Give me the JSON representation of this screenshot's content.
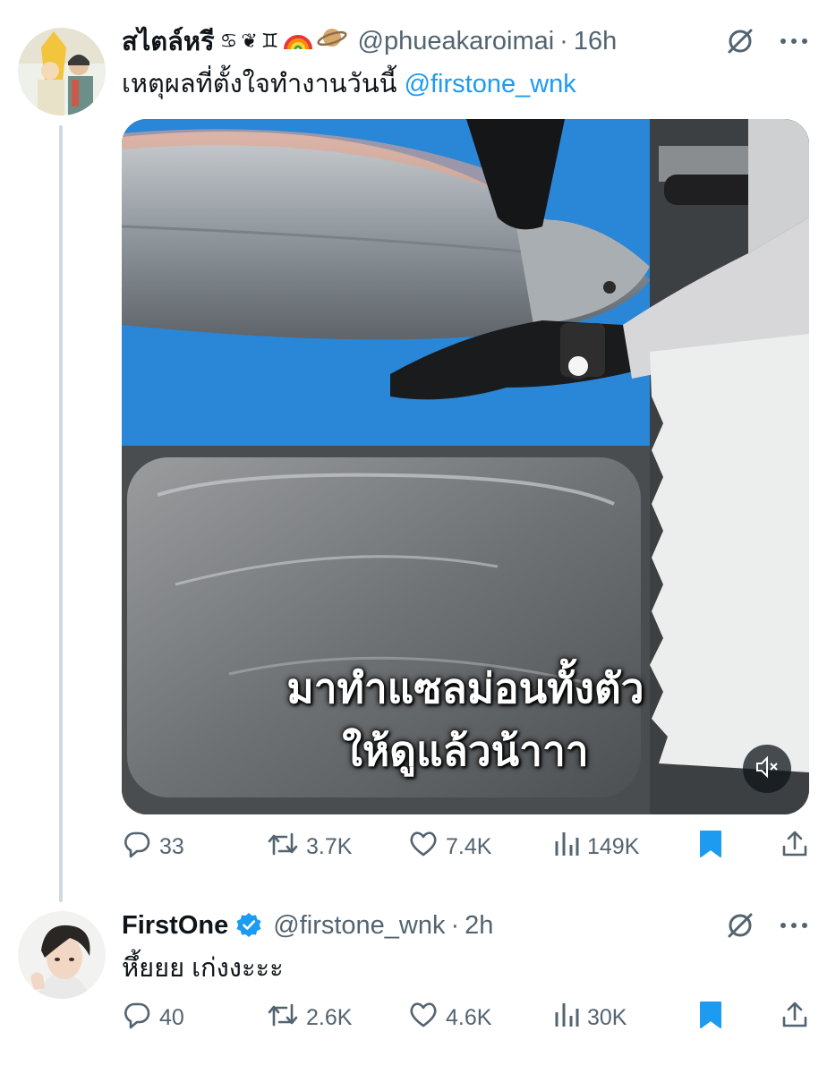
{
  "tweets": [
    {
      "display_name": "สไตล์หรี",
      "emojis": [
        "♋",
        "❦",
        "♊",
        "rainbow",
        "planet"
      ],
      "handle": "@phueakaroimai",
      "time": "16h",
      "text": "เหตุผลที่ตั้งใจทำงานวันนี้",
      "mention": "@firstone_wnk",
      "video": {
        "caption_line1": "มาทำแซลม่อนทั้งตัว",
        "caption_line2": "ให้ดูแล้วน้าาา",
        "muted": true
      },
      "stats": {
        "replies": "33",
        "retweets": "3.7K",
        "likes": "7.4K",
        "views": "149K",
        "bookmarked": true
      }
    },
    {
      "display_name": "FirstOne",
      "verified": true,
      "handle": "@firstone_wnk",
      "time": "2h",
      "text": "หึ้ยยย เก่งงะะะ",
      "stats": {
        "replies": "40",
        "retweets": "2.6K",
        "likes": "4.6K",
        "views": "30K",
        "bookmarked": true
      }
    }
  ],
  "icons": [
    "grok-icon",
    "more-icon",
    "reply-icon",
    "retweet-icon",
    "like-icon",
    "views-icon",
    "bookmark-icon",
    "share-icon",
    "verified-icon",
    "mute-icon"
  ],
  "colors": {
    "accent": "#1d9bf0",
    "muted_text": "#536471",
    "thread_line": "#cfd9de",
    "bookmark": "#1d9bf0"
  }
}
